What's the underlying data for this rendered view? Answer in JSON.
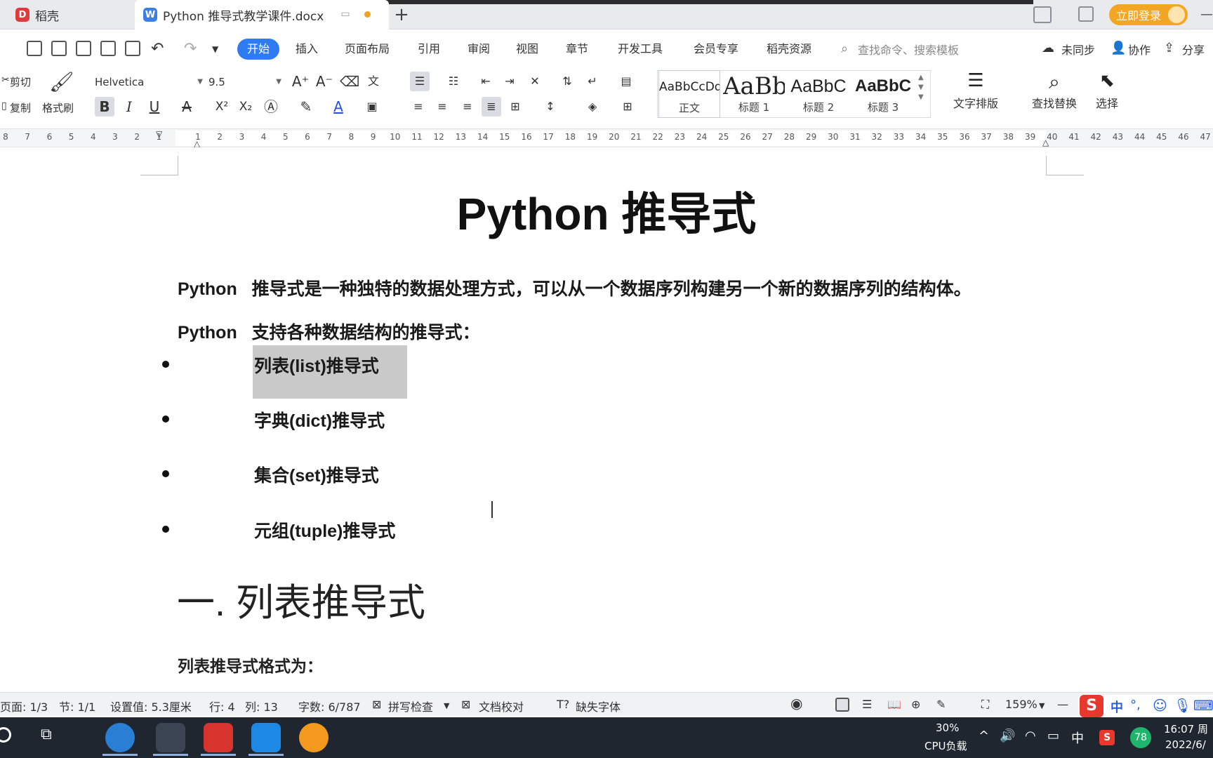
{
  "tabs": {
    "docer": "稻壳",
    "doc": "Python 推导式教学课件.docx"
  },
  "titlebar": {
    "login": "立即登录"
  },
  "menu": {
    "start": "开始",
    "insert": "插入",
    "layout": "页面布局",
    "references": "引用",
    "review": "审阅",
    "view": "视图",
    "chapter": "章节",
    "devtools": "开发工具",
    "vip": "会员专享",
    "resources": "稻壳资源",
    "search_placeholder": "查找命令、搜索模板",
    "unsynced": "未同步",
    "collab": "协作",
    "share": "分享"
  },
  "ribbon": {
    "cut": "剪切",
    "copy": "复制",
    "format_painter": "格式刷",
    "font_name": "Helvetica",
    "font_size": "9.5",
    "styles": [
      {
        "preview": "AaBbCcDd",
        "name": "正文"
      },
      {
        "preview": "AaBb",
        "name": "标题 1"
      },
      {
        "preview": "AaBbC",
        "name": "标题 2"
      },
      {
        "preview": "AaBbC",
        "name": "标题 3"
      }
    ],
    "text_layout": "文字排版",
    "find_replace": "查找替换",
    "select": "选择"
  },
  "ruler": {
    "left_ticks": [
      "8",
      "7",
      "6",
      "5",
      "4",
      "3",
      "2",
      "1"
    ],
    "right_ticks": [
      "1",
      "2",
      "3",
      "4",
      "5",
      "6",
      "7",
      "8",
      "9",
      "10",
      "11",
      "12",
      "13",
      "14",
      "15",
      "16",
      "17",
      "18",
      "19",
      "20",
      "21",
      "22",
      "23",
      "24",
      "25",
      "26",
      "27",
      "28",
      "29",
      "30",
      "31",
      "32",
      "33",
      "34",
      "35",
      "36",
      "37",
      "38",
      "39",
      "40",
      "41",
      "42",
      "43",
      "44",
      "45",
      "46",
      "47"
    ]
  },
  "document": {
    "title": "Python  推导式",
    "intro1_prefix": "Python",
    "intro1_text": "推导式是一种独特的数据处理方式，可以从一个数据序列构建另一个新的数据序列的结构体。",
    "intro2_prefix": "Python",
    "intro2_text": "支持各种数据结构的推导式：",
    "bullets": [
      "列表(list)推导式",
      "字典(dict)推导式",
      "集合(set)推导式",
      "元组(tuple)推导式"
    ],
    "heading1": "一.  列表推导式",
    "para_format": "列表推导式格式为："
  },
  "status": {
    "page": "页面: 1/3",
    "section": "节: 1/1",
    "setting": "设置值: 5.3厘米",
    "row": "行: 4",
    "col": "列: 13",
    "words": "字数: 6/787",
    "spellcheck": "拼写检查",
    "proofread": "文档校对",
    "missing_font": "缺失字体",
    "zoom": "159%"
  },
  "ime": {
    "lang": "中"
  },
  "tray": {
    "cpu_percent": "30%",
    "cpu_label": "CPU负载",
    "lang": "中",
    "badge": "78",
    "time": "16:07 周",
    "date": "2022/6/"
  },
  "colors": {
    "accent": "#2f7bf1",
    "login": "#f4a523",
    "highlight": "#c9c9c9",
    "taskbar": "#1f2630"
  }
}
